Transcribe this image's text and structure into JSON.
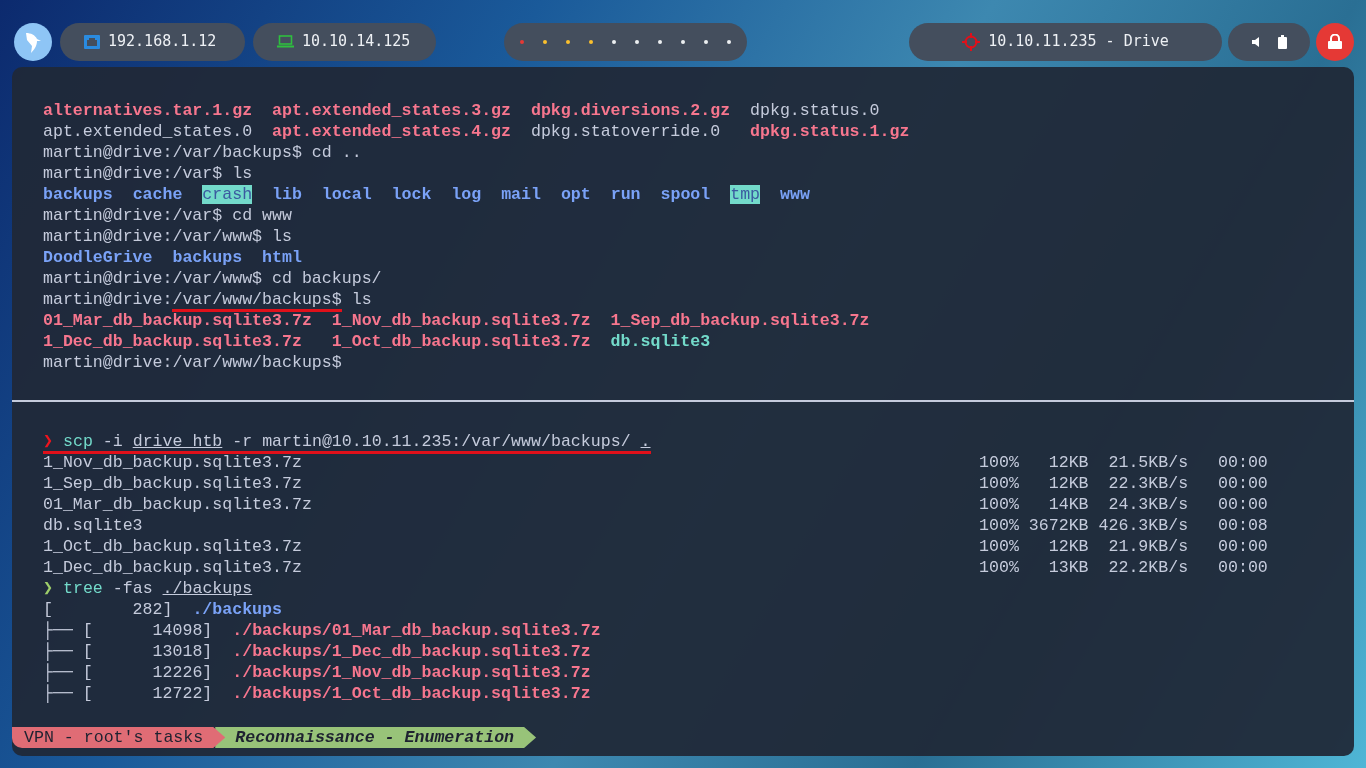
{
  "top_bar": {
    "network": {
      "address": "192.168.1.12"
    },
    "vpn": {
      "address": "10.10.14.125"
    },
    "workspaces": [
      {
        "color": "#e53935"
      },
      {
        "color": "#fbc02d"
      },
      {
        "color": "#fbc02d"
      },
      {
        "color": "#fbc02d"
      },
      {
        "color": "#eceff1"
      },
      {
        "color": "#eceff1"
      },
      {
        "color": "#eceff1"
      },
      {
        "color": "#eceff1"
      },
      {
        "color": "#eceff1"
      },
      {
        "color": "#eceff1"
      }
    ],
    "target": {
      "label": "10.10.11.235 - Drive"
    }
  },
  "terminal": {
    "top_pane": {
      "lines": [
        {
          "segments": [
            {
              "text": "alternatives.tar.1.gz  ",
              "kind": "archive"
            },
            {
              "text": "apt.extended_states.3.gz  ",
              "kind": "archive"
            },
            {
              "text": "dpkg.diversions.2.gz  ",
              "kind": "archive"
            },
            {
              "text": "dpkg.status.0",
              "kind": "plain"
            }
          ]
        },
        {
          "segments": [
            {
              "text": "apt.extended_states.0  ",
              "kind": "plain"
            },
            {
              "text": "apt.extended_states.4.gz  ",
              "kind": "archive"
            },
            {
              "text": "dpkg.statoverride.0   ",
              "kind": "plain"
            },
            {
              "text": "dpkg.status.1.gz",
              "kind": "archive"
            }
          ]
        },
        {
          "segments": [
            {
              "text": "martin@drive:/var/backups$ cd ..",
              "kind": "plain"
            }
          ]
        },
        {
          "segments": [
            {
              "text": "martin@drive:/var$ ls",
              "kind": "plain"
            }
          ]
        },
        {
          "segments": [
            {
              "text": "backups  ",
              "kind": "directory"
            },
            {
              "text": "cache  ",
              "kind": "directory"
            },
            {
              "text": "crash",
              "kind": "sticky"
            },
            {
              "text": "  lib  ",
              "kind": "directory"
            },
            {
              "text": "local  ",
              "kind": "directory"
            },
            {
              "text": "lock  ",
              "kind": "directory"
            },
            {
              "text": "log  ",
              "kind": "directory"
            },
            {
              "text": "mail  ",
              "kind": "directory"
            },
            {
              "text": "opt  ",
              "kind": "directory"
            },
            {
              "text": "run  ",
              "kind": "directory"
            },
            {
              "text": "spool  ",
              "kind": "directory"
            },
            {
              "text": "tmp",
              "kind": "sticky"
            },
            {
              "text": "  www",
              "kind": "directory"
            }
          ]
        },
        {
          "segments": [
            {
              "text": "martin@drive:/var$ cd www",
              "kind": "plain"
            }
          ]
        },
        {
          "segments": [
            {
              "text": "martin@drive:/var/www$ ls",
              "kind": "plain"
            }
          ]
        },
        {
          "segments": [
            {
              "text": "DoodleGrive  ",
              "kind": "directory"
            },
            {
              "text": "backups  ",
              "kind": "directory"
            },
            {
              "text": "html",
              "kind": "directory"
            }
          ]
        },
        {
          "segments": [
            {
              "text": "martin@drive:/var/www$ cd backups/",
              "kind": "plain"
            }
          ]
        },
        {
          "segments": [
            {
              "text": "martin@drive:",
              "kind": "plain"
            },
            {
              "text": "/var/www/backups$",
              "kind": "marked"
            },
            {
              "text": " ls",
              "kind": "plain"
            }
          ]
        },
        {
          "segments": [
            {
              "text": "01_Mar_db_backup.sqlite3.7z  ",
              "kind": "archive"
            },
            {
              "text": "1_Nov_db_backup.sqlite3.7z  ",
              "kind": "archive"
            },
            {
              "text": "1_Sep_db_backup.sqlite3.7z",
              "kind": "archive"
            }
          ]
        },
        {
          "segments": [
            {
              "text": "1_Dec_db_backup.sqlite3.7z   ",
              "kind": "archive"
            },
            {
              "text": "1_Oct_db_backup.sqlite3.7z  ",
              "kind": "archive"
            },
            {
              "text": "db.sqlite3",
              "kind": "database"
            }
          ]
        },
        {
          "segments": [
            {
              "text": "martin@drive:/var/www/backups$",
              "kind": "plain"
            }
          ]
        }
      ]
    },
    "bottom_pane": {
      "scp_command": {
        "arrow": "❯",
        "kind": "failed",
        "annotated": true,
        "segments": [
          {
            "text": "scp",
            "kind": "command"
          },
          {
            "text": " -i ",
            "kind": "plain"
          },
          {
            "text": "drive_htb",
            "kind": "path"
          },
          {
            "text": " -r martin@10.10.11.235:/var/www/backups/ ",
            "kind": "plain"
          },
          {
            "text": ".",
            "kind": "path"
          }
        ]
      },
      "transfers": [
        {
          "file": "1_Nov_db_backup.sqlite3.7z",
          "percent": "100%",
          "size": "12KB",
          "rate": "21.5KB/s",
          "time": "00:00"
        },
        {
          "file": "1_Sep_db_backup.sqlite3.7z",
          "percent": "100%",
          "size": "12KB",
          "rate": "22.3KB/s",
          "time": "00:00"
        },
        {
          "file": "01_Mar_db_backup.sqlite3.7z",
          "percent": "100%",
          "size": "14KB",
          "rate": "24.3KB/s",
          "time": "00:00"
        },
        {
          "file": "db.sqlite3",
          "percent": "100%",
          "size": "3672KB",
          "rate": "426.3KB/s",
          "time": "00:08"
        },
        {
          "file": "1_Oct_db_backup.sqlite3.7z",
          "percent": "100%",
          "size": "12KB",
          "rate": "21.9KB/s",
          "time": "00:00"
        },
        {
          "file": "1_Dec_db_backup.sqlite3.7z",
          "percent": "100%",
          "size": "13KB",
          "rate": "22.2KB/s",
          "time": "00:00"
        }
      ],
      "tree_command": {
        "arrow": "❯",
        "kind": "succeeded",
        "segments": [
          {
            "text": "tree",
            "kind": "command"
          },
          {
            "text": " -fas ",
            "kind": "plain"
          },
          {
            "text": "./backups",
            "kind": "path"
          }
        ]
      },
      "tree": {
        "size": "[        282]",
        "path": "./backups",
        "children": [
          {
            "branch": "├── ",
            "size": "[      14098]",
            "path": "./backups/01_Mar_db_backup.sqlite3.7z"
          },
          {
            "branch": "├── ",
            "size": "[      13018]",
            "path": "./backups/1_Dec_db_backup.sqlite3.7z"
          },
          {
            "branch": "├── ",
            "size": "[      12226]",
            "path": "./backups/1_Nov_db_backup.sqlite3.7z"
          },
          {
            "branch": "├── ",
            "size": "[      12722]",
            "path": "./backups/1_Oct_db_backup.sqlite3.7z"
          }
        ]
      }
    },
    "status_bar": [
      {
        "text": "VPN - root's tasks",
        "kind": "session"
      },
      {
        "text": "Reconnaissance - Enumeration",
        "kind": "task"
      }
    ]
  }
}
